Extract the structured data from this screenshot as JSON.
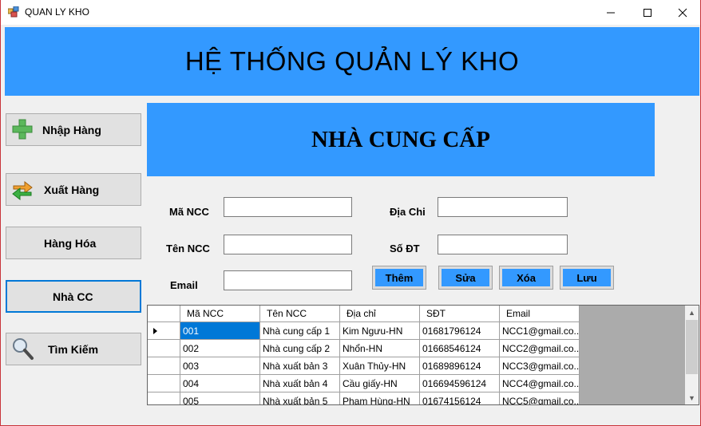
{
  "window": {
    "title": "QUAN LY KHO"
  },
  "header": {
    "title": "HỆ THỐNG QUẢN LÝ KHO"
  },
  "sidebar": {
    "items": [
      {
        "label": "Nhập Hàng",
        "icon": "plus-icon"
      },
      {
        "label": "Xuất Hàng",
        "icon": "swap-arrows-icon"
      },
      {
        "label": "Hàng Hóa",
        "icon": ""
      },
      {
        "label": "Nhà CC",
        "icon": "",
        "active": true
      },
      {
        "label": "Tìm Kiếm",
        "icon": "magnifier-icon"
      }
    ]
  },
  "section": {
    "title": "NHÀ CUNG CẤP"
  },
  "form": {
    "ma_ncc": {
      "label": "Mã NCC",
      "value": ""
    },
    "ten_ncc": {
      "label": "Tên NCC",
      "value": ""
    },
    "email": {
      "label": "Email",
      "value": ""
    },
    "dia_chi": {
      "label": "Địa Chi",
      "value": ""
    },
    "so_dt": {
      "label": "Số ĐT",
      "value": ""
    }
  },
  "actions": {
    "them": "Thêm",
    "sua": "Sửa",
    "xoa": "Xóa",
    "luu": "Lưu"
  },
  "grid": {
    "columns": [
      "Mã NCC",
      "Tên NCC",
      "Địa chỉ",
      "SĐT",
      "Email"
    ],
    "rows": [
      [
        "001",
        "Nhà cung cấp 1",
        "Kim Ngưu-HN",
        "01681796124",
        "NCC1@gmail.co..."
      ],
      [
        "002",
        "Nhà cung cấp 2",
        "Nhổn-HN",
        "01668546124",
        "NCC2@gmail.co..."
      ],
      [
        "003",
        "Nhà xuất bản 3",
        "Xuân Thủy-HN",
        "01689896124",
        "NCC3@gmail.co..."
      ],
      [
        "004",
        "Nhà xuất bản 4",
        "Cầu giấy-HN",
        "016694596124",
        "NCC4@gmail.co..."
      ],
      [
        "005",
        "Nhà xuất bản 5",
        "Phạm Hùng-HN",
        "01674156124",
        "NCC5@gmail.co..."
      ]
    ],
    "selected_row": 0
  },
  "colors": {
    "accent": "#3399ff",
    "selection": "#0078d7"
  }
}
